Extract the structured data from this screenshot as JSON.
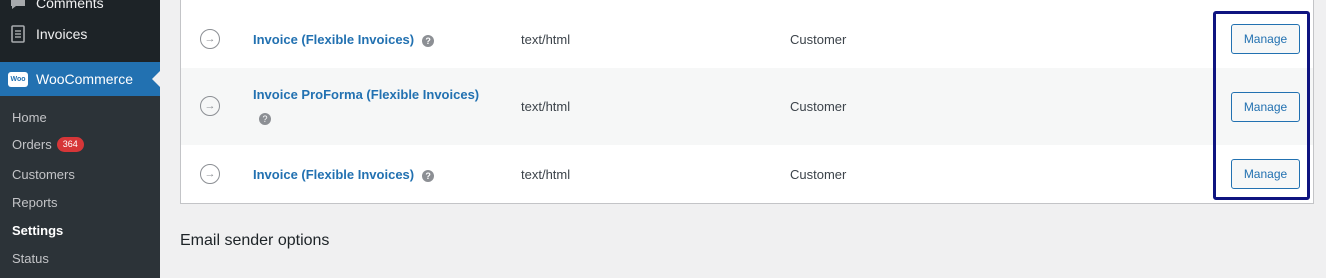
{
  "sidebar": {
    "comments_label": "Comments",
    "invoices_label": "Invoices",
    "woocommerce_label": "WooCommerce",
    "woo_logo_text": "Woo",
    "submenu": {
      "home": "Home",
      "orders": "Orders",
      "orders_count": "364",
      "customers": "Customers",
      "reports": "Reports",
      "settings": "Settings",
      "status": "Status"
    }
  },
  "emails": {
    "rows": [
      {
        "name": "Invoice (Flexible Invoices)",
        "content_type": "text/html",
        "recipient": "Customer",
        "action": "Manage"
      },
      {
        "name": "Invoice ProForma (Flexible Invoices)",
        "content_type": "text/html",
        "recipient": "Customer",
        "action": "Manage"
      },
      {
        "name": "Invoice (Flexible Invoices)",
        "content_type": "text/html",
        "recipient": "Customer",
        "action": "Manage"
      }
    ]
  },
  "help_tip_glyph": "?",
  "status_glyph": "→",
  "section": {
    "heading": "Email sender options"
  },
  "colors": {
    "accent": "#2271b1",
    "highlight": "#0f1480",
    "sidebar_bg": "#1d2327",
    "badge": "#d63638"
  }
}
